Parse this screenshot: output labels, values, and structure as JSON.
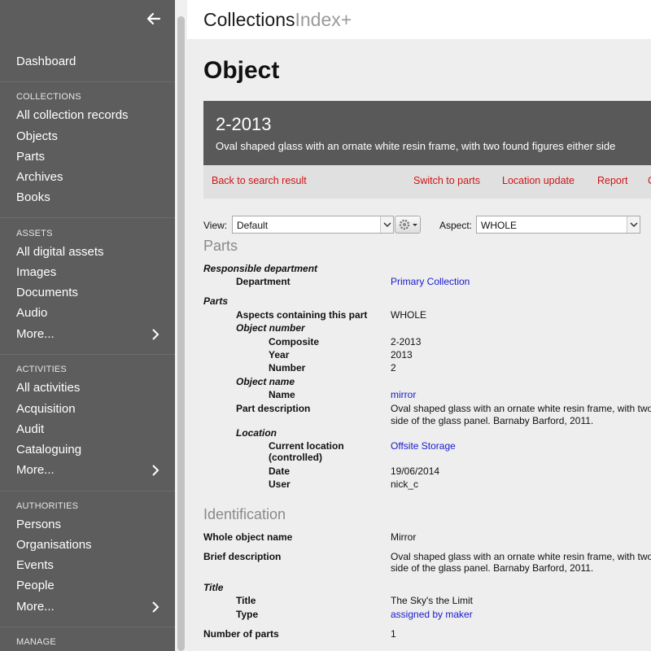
{
  "sidebar": {
    "top_items": [
      {
        "label": "Dashboard"
      }
    ],
    "sections": [
      {
        "title": "COLLECTIONS",
        "items": [
          {
            "label": "All collection records"
          },
          {
            "label": "Objects"
          },
          {
            "label": "Parts"
          },
          {
            "label": "Archives"
          },
          {
            "label": "Books"
          }
        ]
      },
      {
        "title": "ASSETS",
        "items": [
          {
            "label": "All digital assets"
          },
          {
            "label": "Images"
          },
          {
            "label": "Documents"
          },
          {
            "label": "Audio"
          },
          {
            "label": "More..."
          }
        ]
      },
      {
        "title": "ACTIVITIES",
        "items": [
          {
            "label": "All activities"
          },
          {
            "label": "Acquisition"
          },
          {
            "label": "Audit"
          },
          {
            "label": "Cataloguing"
          },
          {
            "label": "More..."
          }
        ]
      },
      {
        "title": "AUTHORITIES",
        "items": [
          {
            "label": "Persons"
          },
          {
            "label": "Organisations"
          },
          {
            "label": "Events"
          },
          {
            "label": "People"
          },
          {
            "label": "More..."
          }
        ]
      },
      {
        "title": "MANAGE",
        "items": []
      }
    ],
    "collapse_icon": "arrow-left-icon",
    "more_icon": "chevron-right-icon"
  },
  "header": {
    "logo_main": "Collections",
    "logo_suffix": "Index+"
  },
  "page": {
    "title": "Object"
  },
  "record": {
    "id": "2-2013",
    "description": "Oval shaped glass with an ornate white resin frame, with two found figures either side"
  },
  "actions": {
    "back": "Back to search result",
    "switch": "Switch to parts",
    "location": "Location update",
    "report": "Report",
    "more": "C"
  },
  "view": {
    "label": "View:",
    "value": "Default"
  },
  "aspect": {
    "label": "Aspect:",
    "value": "WHOLE"
  },
  "parts": {
    "heading": "Parts",
    "responsible_department": {
      "group": "Responsible department",
      "label": "Department",
      "value": "Primary Collection"
    },
    "parts_group": "Parts",
    "aspects_label": "Aspects containing this part",
    "aspects_value": "WHOLE",
    "object_number": {
      "group": "Object number",
      "composite_label": "Composite",
      "composite": "2-2013",
      "year_label": "Year",
      "year": "2013",
      "number_label": "Number",
      "number": "2"
    },
    "object_name": {
      "group": "Object name",
      "name_label": "Name",
      "name": "mirror"
    },
    "part_description": {
      "label": "Part description",
      "line1": "Oval shaped glass with an ornate white resin frame, with two",
      "line2": "side of the glass panel. Barnaby Barford, 2011."
    },
    "location": {
      "group": "Location",
      "current_label_1": "Current location",
      "current_label_2": "(controlled)",
      "current": "Offsite Storage",
      "date_label": "Date",
      "date": "19/06/2014",
      "user_label": "User",
      "user": "nick_c"
    }
  },
  "identification": {
    "heading": "Identification",
    "whole_name_label": "Whole object name",
    "whole_name": "Mirror",
    "brief_label": "Brief description",
    "brief_line1": "Oval shaped glass with an ornate white resin frame, with two",
    "brief_line2": "side of the glass panel. Barnaby Barford, 2011.",
    "title_group": "Title",
    "title_label": "Title",
    "title": "The Sky's the Limit",
    "type_label": "Type",
    "type": "assigned by maker",
    "num_parts_label": "Number of parts",
    "num_parts": "1"
  }
}
